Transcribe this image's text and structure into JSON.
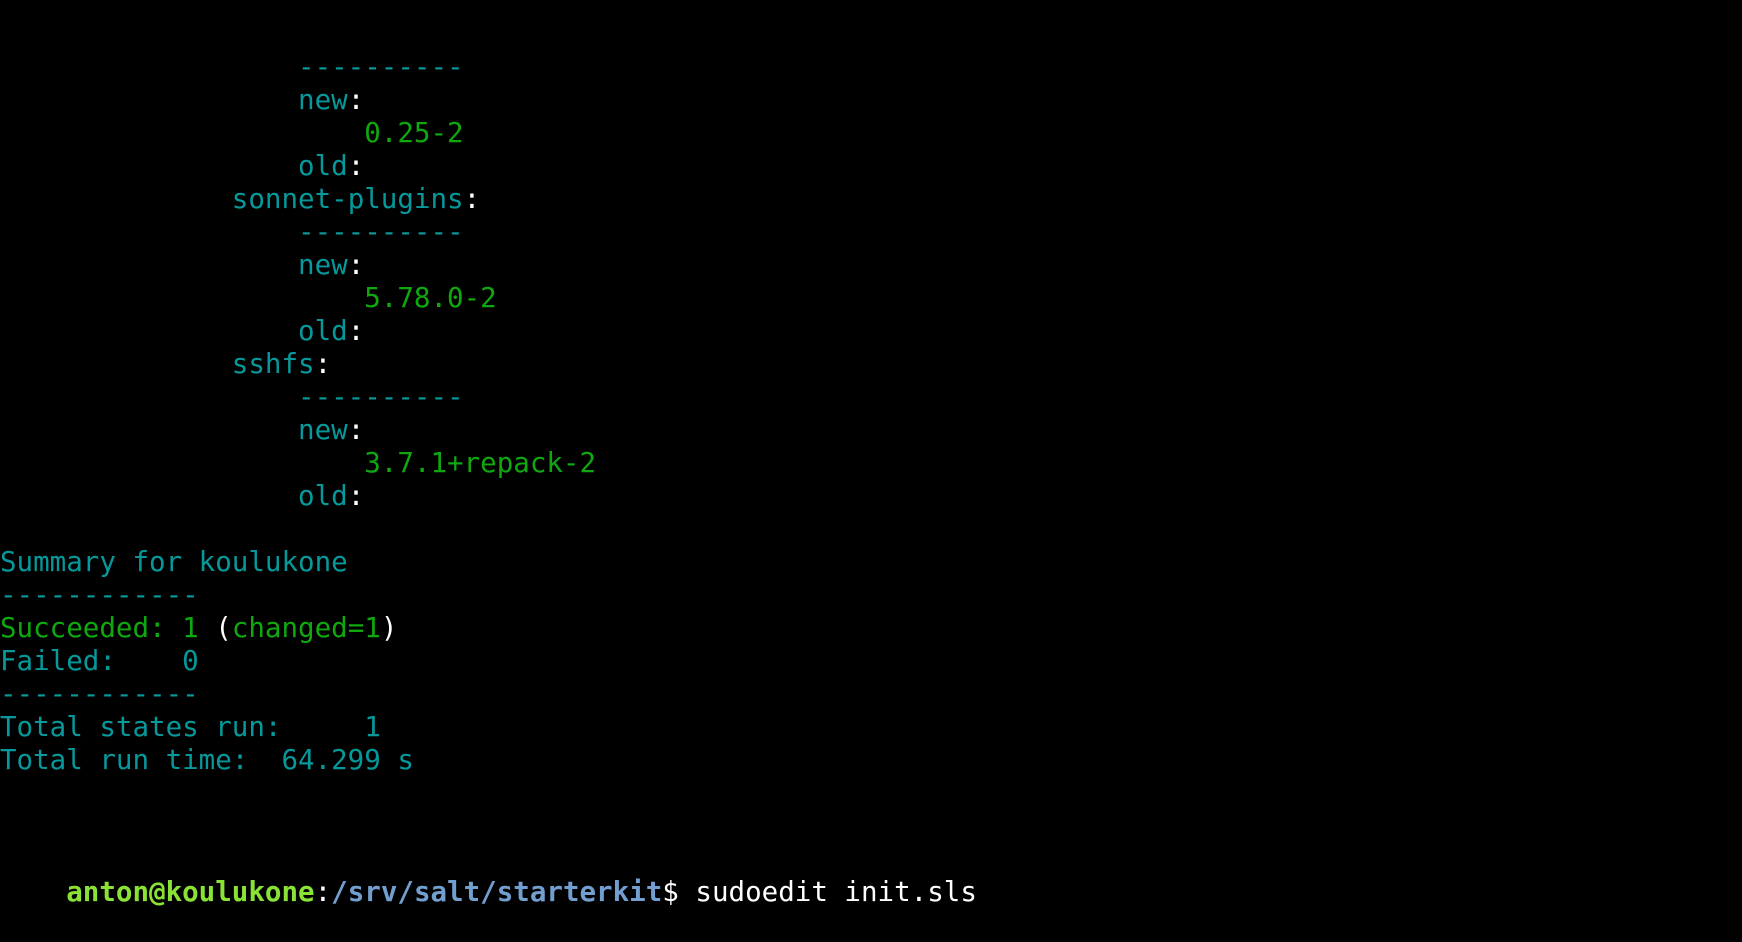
{
  "terminal": {
    "lines": [
      {
        "indent": "                  ",
        "parts": [
          {
            "text": "----------",
            "cls": "cyan"
          }
        ]
      },
      {
        "indent": "                  ",
        "parts": [
          {
            "text": "new",
            "cls": "cyan"
          },
          {
            "text": ":",
            "cls": "white"
          }
        ]
      },
      {
        "indent": "                      ",
        "parts": [
          {
            "text": "0.25-2",
            "cls": "green2"
          }
        ]
      },
      {
        "indent": "                  ",
        "parts": [
          {
            "text": "old",
            "cls": "cyan"
          },
          {
            "text": ":",
            "cls": "white"
          }
        ]
      },
      {
        "indent": "              ",
        "parts": [
          {
            "text": "sonnet-plugins",
            "cls": "cyan"
          },
          {
            "text": ":",
            "cls": "white"
          }
        ]
      },
      {
        "indent": "                  ",
        "parts": [
          {
            "text": "----------",
            "cls": "cyan"
          }
        ]
      },
      {
        "indent": "                  ",
        "parts": [
          {
            "text": "new",
            "cls": "cyan"
          },
          {
            "text": ":",
            "cls": "white"
          }
        ]
      },
      {
        "indent": "                      ",
        "parts": [
          {
            "text": "5.78.0-2",
            "cls": "green2"
          }
        ]
      },
      {
        "indent": "                  ",
        "parts": [
          {
            "text": "old",
            "cls": "cyan"
          },
          {
            "text": ":",
            "cls": "white"
          }
        ]
      },
      {
        "indent": "              ",
        "parts": [
          {
            "text": "sshfs",
            "cls": "cyan"
          },
          {
            "text": ":",
            "cls": "white"
          }
        ]
      },
      {
        "indent": "                  ",
        "parts": [
          {
            "text": "----------",
            "cls": "cyan"
          }
        ]
      },
      {
        "indent": "                  ",
        "parts": [
          {
            "text": "new",
            "cls": "cyan"
          },
          {
            "text": ":",
            "cls": "white"
          }
        ]
      },
      {
        "indent": "                      ",
        "parts": [
          {
            "text": "3.7.1+repack-2",
            "cls": "green2"
          }
        ]
      },
      {
        "indent": "                  ",
        "parts": [
          {
            "text": "old",
            "cls": "cyan"
          },
          {
            "text": ":",
            "cls": "white"
          }
        ]
      },
      {
        "indent": "",
        "parts": []
      },
      {
        "indent": "",
        "parts": [
          {
            "text": "Summary for koulukone",
            "cls": "cyan"
          }
        ]
      },
      {
        "indent": "",
        "parts": [
          {
            "text": "------------",
            "cls": "cyan"
          }
        ]
      },
      {
        "indent": "",
        "parts": [
          {
            "text": "Succeeded: 1",
            "cls": "green2"
          },
          {
            "text": " (",
            "cls": "white"
          },
          {
            "text": "changed=1",
            "cls": "green2"
          },
          {
            "text": ")",
            "cls": "white"
          }
        ]
      },
      {
        "indent": "",
        "parts": [
          {
            "text": "Failed:    0",
            "cls": "cyan"
          }
        ]
      },
      {
        "indent": "",
        "parts": [
          {
            "text": "------------",
            "cls": "cyan"
          }
        ]
      },
      {
        "indent": "",
        "parts": [
          {
            "text": "Total states run:     1",
            "cls": "cyan"
          }
        ]
      },
      {
        "indent": "",
        "parts": [
          {
            "text": "Total run time:  64.299 s",
            "cls": "cyan"
          }
        ]
      }
    ],
    "prompt": {
      "user_host": "anton@koulukone",
      "separator": ":",
      "path": "/srv/salt/starterkit",
      "symbol": "$ ",
      "command": "sudoedit init.sls"
    }
  },
  "colors": {
    "background": "#000000",
    "cyan": "#06989a",
    "green": "#0fa80f",
    "prompt_user": "#8ae234",
    "prompt_path": "#729fcf"
  }
}
